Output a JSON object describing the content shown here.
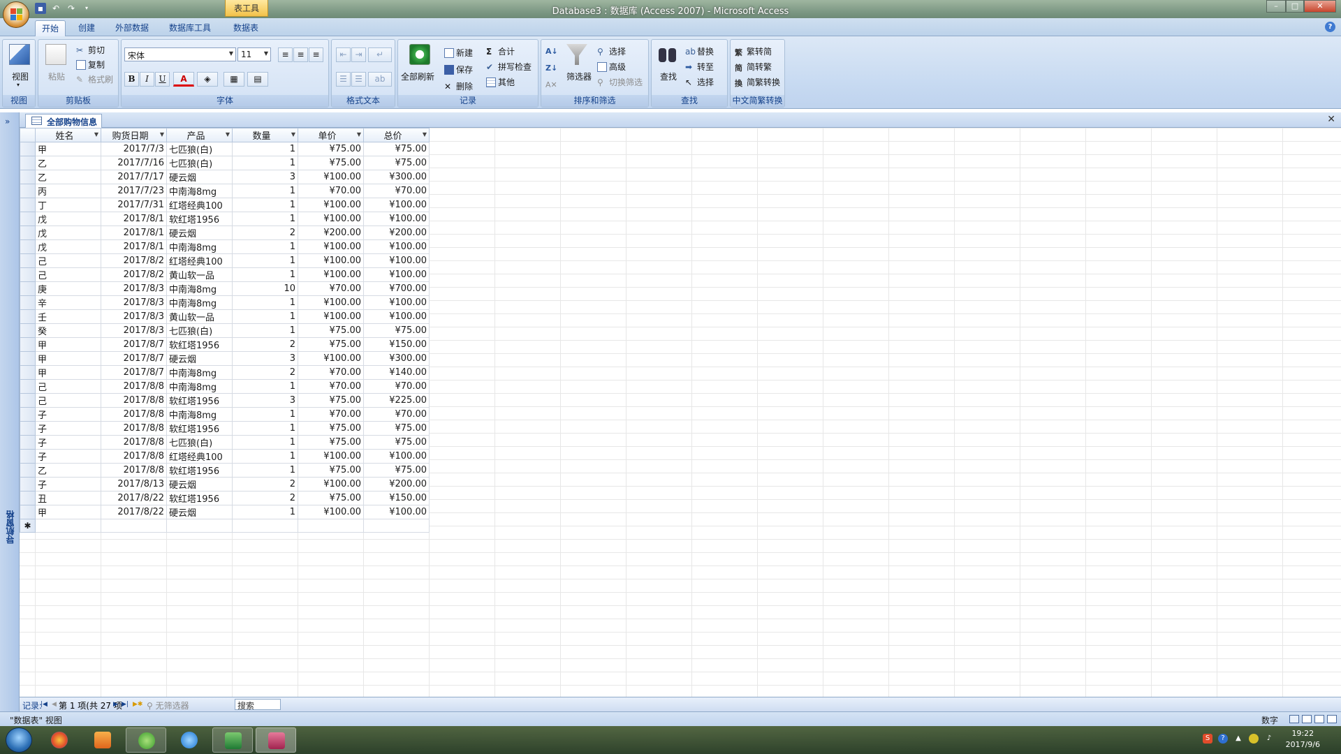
{
  "window": {
    "title": "Database3 : 数据库 (Access 2007) - Microsoft Access",
    "contextual_tab": "表工具",
    "minimize": "–",
    "maximize": "□",
    "close": "✕"
  },
  "ribbon_tabs": [
    "开始",
    "创建",
    "外部数据",
    "数据库工具",
    "数据表"
  ],
  "ribbon": {
    "view": {
      "label": "视图",
      "group": "视图"
    },
    "clipboard": {
      "paste": "粘贴",
      "cut": "剪切",
      "copy": "复制",
      "format_painter": "格式刷",
      "group": "剪贴板"
    },
    "font": {
      "name": "宋体",
      "size": "11",
      "bold": "B",
      "italic": "I",
      "underline": "U",
      "group": "字体"
    },
    "rich_text": {
      "group": "格式文本"
    },
    "records": {
      "refresh": "全部刷新",
      "new": "新建",
      "save": "保存",
      "delete": "删除",
      "totals": "合计",
      "spelling": "拼写检查",
      "more": "其他",
      "group": "记录"
    },
    "sort_filter": {
      "filter": "筛选器",
      "selection": "选择",
      "advanced": "高级",
      "toggle": "切换筛选",
      "group": "排序和筛选"
    },
    "find": {
      "find": "查找",
      "replace": "替换",
      "goto": "转至",
      "select": "选择",
      "group": "查找"
    },
    "chinese": {
      "t2s": "繁转简",
      "s2t": "简转繁",
      "convert": "简繁转换",
      "group": "中文简繁转换"
    }
  },
  "document": {
    "tab_title": "全部购物信息",
    "nav_pane_label": "导航窗格"
  },
  "table": {
    "columns": [
      "姓名",
      "购货日期",
      "产品",
      "数量",
      "单价",
      "总价"
    ],
    "rows": [
      [
        "甲",
        "2017/7/3",
        "七匹狼(白)",
        "1",
        "¥75.00",
        "¥75.00"
      ],
      [
        "乙",
        "2017/7/16",
        "七匹狼(白)",
        "1",
        "¥75.00",
        "¥75.00"
      ],
      [
        "乙",
        "2017/7/17",
        "硬云烟",
        "3",
        "¥100.00",
        "¥300.00"
      ],
      [
        "丙",
        "2017/7/23",
        "中南海8mg",
        "1",
        "¥70.00",
        "¥70.00"
      ],
      [
        "丁",
        "2017/7/31",
        "红塔经典100",
        "1",
        "¥100.00",
        "¥100.00"
      ],
      [
        "戊",
        "2017/8/1",
        "软红塔1956",
        "1",
        "¥100.00",
        "¥100.00"
      ],
      [
        "戊",
        "2017/8/1",
        "硬云烟",
        "2",
        "¥200.00",
        "¥200.00"
      ],
      [
        "戊",
        "2017/8/1",
        "中南海8mg",
        "1",
        "¥100.00",
        "¥100.00"
      ],
      [
        "己",
        "2017/8/2",
        "红塔经典100",
        "1",
        "¥100.00",
        "¥100.00"
      ],
      [
        "己",
        "2017/8/2",
        "黄山软一品",
        "1",
        "¥100.00",
        "¥100.00"
      ],
      [
        "庚",
        "2017/8/3",
        "中南海8mg",
        "10",
        "¥70.00",
        "¥700.00"
      ],
      [
        "辛",
        "2017/8/3",
        "中南海8mg",
        "1",
        "¥100.00",
        "¥100.00"
      ],
      [
        "壬",
        "2017/8/3",
        "黄山软一品",
        "1",
        "¥100.00",
        "¥100.00"
      ],
      [
        "癸",
        "2017/8/3",
        "七匹狼(白)",
        "1",
        "¥75.00",
        "¥75.00"
      ],
      [
        "甲",
        "2017/8/7",
        "软红塔1956",
        "2",
        "¥75.00",
        "¥150.00"
      ],
      [
        "甲",
        "2017/8/7",
        "硬云烟",
        "3",
        "¥100.00",
        "¥300.00"
      ],
      [
        "甲",
        "2017/8/7",
        "中南海8mg",
        "2",
        "¥70.00",
        "¥140.00"
      ],
      [
        "己",
        "2017/8/8",
        "中南海8mg",
        "1",
        "¥70.00",
        "¥70.00"
      ],
      [
        "己",
        "2017/8/8",
        "软红塔1956",
        "3",
        "¥75.00",
        "¥225.00"
      ],
      [
        "子",
        "2017/8/8",
        "中南海8mg",
        "1",
        "¥70.00",
        "¥70.00"
      ],
      [
        "子",
        "2017/8/8",
        "软红塔1956",
        "1",
        "¥75.00",
        "¥75.00"
      ],
      [
        "子",
        "2017/8/8",
        "七匹狼(白)",
        "1",
        "¥75.00",
        "¥75.00"
      ],
      [
        "子",
        "2017/8/8",
        "红塔经典100",
        "1",
        "¥100.00",
        "¥100.00"
      ],
      [
        "乙",
        "2017/8/8",
        "软红塔1956",
        "1",
        "¥75.00",
        "¥75.00"
      ],
      [
        "子",
        "2017/8/13",
        "硬云烟",
        "2",
        "¥100.00",
        "¥200.00"
      ],
      [
        "丑",
        "2017/8/22",
        "软红塔1956",
        "2",
        "¥75.00",
        "¥150.00"
      ],
      [
        "甲",
        "2017/8/22",
        "硬云烟",
        "1",
        "¥100.00",
        "¥100.00"
      ]
    ],
    "new_row_marker": "✱"
  },
  "record_nav": {
    "label": "记录:",
    "position": "第 1 项(共 27 项",
    "filter": "无筛选器",
    "search": "搜索"
  },
  "status": {
    "left": "\"数据表\" 视图",
    "right": "数字"
  },
  "taskbar": {
    "time": "19:22",
    "date": "2017/9/6"
  }
}
